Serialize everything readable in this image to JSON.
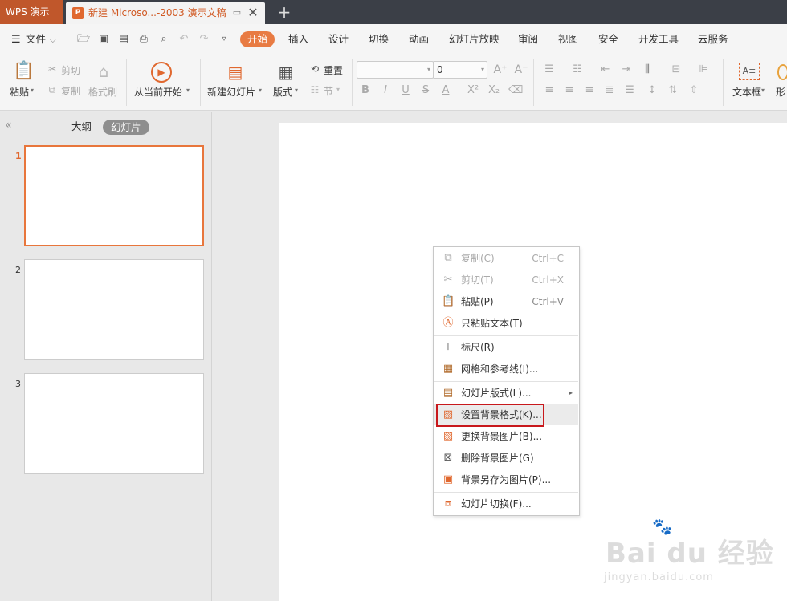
{
  "titlebar": {
    "app_name": "WPS 演示",
    "doc_title": "新建 Microso...-2003 演示文稿",
    "new_tab": "+",
    "close": "✕"
  },
  "menubar": {
    "file_label": "文件",
    "tabs": [
      "开始",
      "插入",
      "设计",
      "切换",
      "动画",
      "幻灯片放映",
      "审阅",
      "视图",
      "安全",
      "开发工具",
      "云服务"
    ],
    "active_tab": "开始"
  },
  "ribbon": {
    "paste": "粘贴",
    "cut": "剪切",
    "copy": "复制",
    "format_painter": "格式刷",
    "from_current": "从当前开始",
    "new_slide": "新建幻灯片",
    "layout": "版式",
    "reset": "重置",
    "section": "节",
    "font_size_value": "0",
    "text_box": "文本框",
    "shape": "形"
  },
  "left_panel": {
    "tab_outline": "大纲",
    "tab_slides": "幻灯片",
    "slide_numbers": [
      "1",
      "2",
      "3"
    ],
    "active_slide": "1"
  },
  "context_menu": {
    "items": [
      {
        "label": "复制(C)",
        "shortcut": "Ctrl+C",
        "icon": "copy-icon",
        "disabled": true
      },
      {
        "label": "剪切(T)",
        "shortcut": "Ctrl+X",
        "icon": "scissors-icon",
        "disabled": true
      },
      {
        "label": "粘贴(P)",
        "shortcut": "Ctrl+V",
        "icon": "clipboard-icon",
        "disabled": false
      },
      {
        "label": "只粘贴文本(T)",
        "shortcut": "",
        "icon": "paste-text-icon",
        "disabled": false
      },
      {
        "label": "标尺(R)",
        "shortcut": "",
        "icon": "ruler-icon",
        "disabled": false
      },
      {
        "label": "网格和参考线(I)...",
        "shortcut": "",
        "icon": "grid-icon",
        "disabled": false
      },
      {
        "label": "幻灯片版式(L)...",
        "shortcut": "",
        "icon": "layout-icon",
        "disabled": false,
        "submenu": true
      },
      {
        "label": "设置背景格式(K)...",
        "shortcut": "",
        "icon": "background-format-icon",
        "disabled": false,
        "highlighted": true
      },
      {
        "label": "更换背景图片(B)...",
        "shortcut": "",
        "icon": "change-background-icon",
        "disabled": false
      },
      {
        "label": "删除背景图片(G)",
        "shortcut": "",
        "icon": "delete-background-icon",
        "disabled": false
      },
      {
        "label": "背景另存为图片(P)...",
        "shortcut": "",
        "icon": "save-background-icon",
        "disabled": false
      },
      {
        "label": "幻灯片切换(F)...",
        "shortcut": "",
        "icon": "slide-transition-icon",
        "disabled": false
      }
    ]
  },
  "watermark": {
    "brand": "Bai du 经验",
    "url": "jingyan.baidu.com"
  },
  "colors": {
    "accent": "#e87b43",
    "titlebar": "#3b3f47",
    "highlight_box": "#c8181c"
  }
}
